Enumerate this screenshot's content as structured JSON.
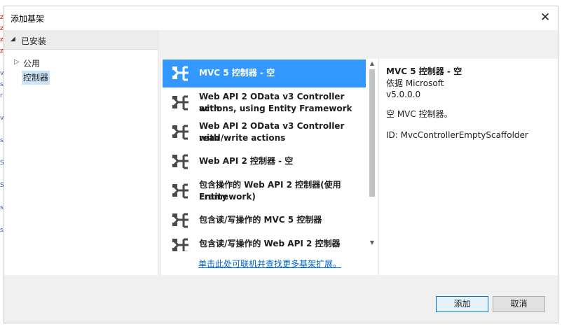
{
  "edge_fragments": [
    "z",
    "z",
    "z",
    "z",
    "v",
    "s",
    "r",
    "v",
    "s",
    "S",
    "S",
    "s",
    "s"
  ],
  "dialog": {
    "title": "添加基架",
    "close_glyph": "✕"
  },
  "tree": {
    "installed_label": "已安装",
    "public_label": "公用",
    "controller_label": "控制器"
  },
  "scaffolders": [
    {
      "line1": "MVC 5 控制器 - 空",
      "line2": "",
      "selected": true
    },
    {
      "line1": "Web API 2 OData v3 Controller with",
      "line2": "actions, using Entity Framework",
      "selected": false
    },
    {
      "line1": "Web API 2 OData v3 Controller with",
      "line2": "read/write actions",
      "selected": false
    },
    {
      "line1": "Web API 2 控制器 - 空",
      "line2": "",
      "selected": false
    },
    {
      "line1": "包含操作的 Web API 2 控制器(使用 Entity",
      "line2": "Framework)",
      "selected": false
    },
    {
      "line1": "包含读/写操作的 MVC 5 控制器",
      "line2": "",
      "selected": false
    },
    {
      "line1": "包含读/写操作的 Web API 2 控制器",
      "line2": "",
      "selected": false
    }
  ],
  "online_link": "单击此处可联机并查找更多基架扩展。",
  "details": {
    "name": "MVC 5 控制器 - 空",
    "author": "依据 Microsoft",
    "version": "v5.0.0.0",
    "description": "空 MVC 控制器。",
    "id": "ID: MvcControllerEmptyScaffolder"
  },
  "buttons": {
    "add": "添加",
    "cancel": "取消"
  },
  "colors": {
    "selection": "#3399ff",
    "link": "#0066cc",
    "tree_selection": "#cce4f7",
    "icon": "#4a4a4a"
  }
}
